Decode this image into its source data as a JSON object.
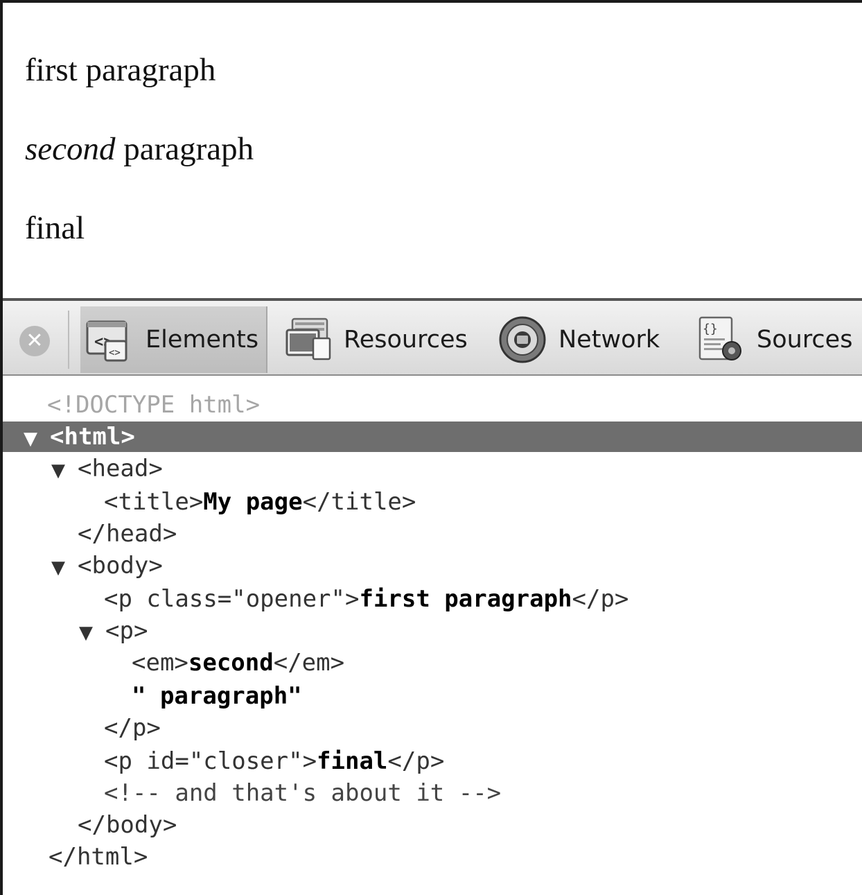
{
  "rendered_page": {
    "paragraph1": "first paragraph",
    "paragraph2_em": "second",
    "paragraph2_rest": " paragraph",
    "paragraph3": "final"
  },
  "devtools": {
    "close_icon": "close-icon",
    "tabs": [
      {
        "label": "Elements",
        "icon": "elements-icon",
        "active": true
      },
      {
        "label": "Resources",
        "icon": "resources-icon",
        "active": false
      },
      {
        "label": "Network",
        "icon": "network-icon",
        "active": false
      },
      {
        "label": "Sources",
        "icon": "sources-icon",
        "active": false
      }
    ]
  },
  "dom_tree": {
    "doctype": "<!DOCTYPE html>",
    "html_open": "<html>",
    "head_open": "<head>",
    "title_open": "<title>",
    "title_text": "My page",
    "title_close": "</title>",
    "head_close": "</head>",
    "body_open": "<body>",
    "p1_open": "<p class=\"opener\">",
    "p1_text": "first paragraph",
    "p1_close": "</p>",
    "p2_open": "<p>",
    "em_open": "<em>",
    "em_text": "second",
    "em_close": "</em>",
    "text_node": "\" paragraph\"",
    "p2_close": "</p>",
    "p3_open": "<p id=\"closer\">",
    "p3_text": "final",
    "p3_close": "</p>",
    "comment": "<!-- and that's about it -->",
    "body_close": "</body>",
    "html_close": "</html>",
    "expand_arrow": "▼"
  }
}
